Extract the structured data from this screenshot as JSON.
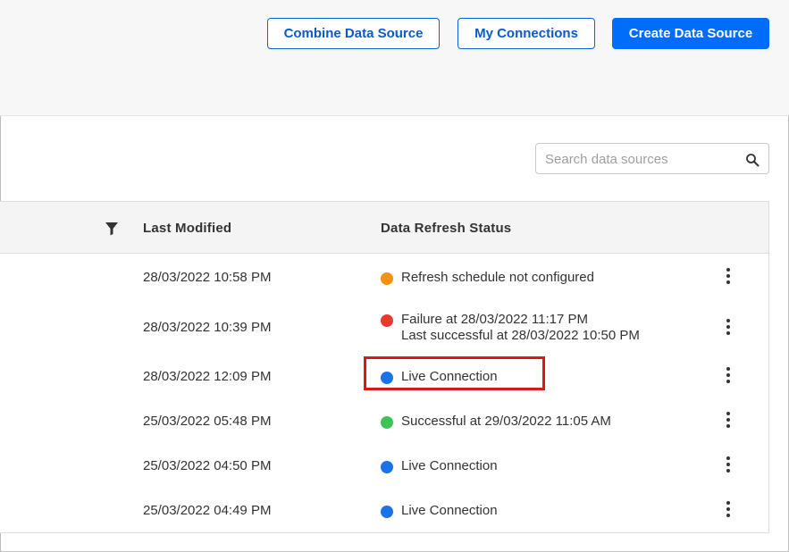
{
  "toolbar": {
    "combine_label": "Combine Data Source",
    "connections_label": "My Connections",
    "create_label": "Create Data Source"
  },
  "search": {
    "placeholder": "Search data sources",
    "value": "",
    "icon": "search-icon"
  },
  "table": {
    "filter_icon": "filter-icon",
    "headers": {
      "last_modified": "Last Modified",
      "refresh_status": "Data Refresh Status"
    },
    "rows": [
      {
        "modified": "28/03/2022 10:58 PM",
        "status_line1": "Refresh schedule not configured",
        "status_line2": "",
        "status_color": "#f39111"
      },
      {
        "modified": "28/03/2022 10:39 PM",
        "status_line1": "Failure at 28/03/2022 11:17 PM",
        "status_line2": "Last successful at 28/03/2022 10:50 PM",
        "status_color": "#ea3a2e"
      },
      {
        "modified": "28/03/2022 12:09 PM",
        "status_line1": "Live Connection",
        "status_line2": "",
        "status_color": "#1a73e8"
      },
      {
        "modified": "25/03/2022 05:48 PM",
        "status_line1": "Successful at 29/03/2022 11:05 AM",
        "status_line2": "",
        "status_color": "#3ec456"
      },
      {
        "modified": "25/03/2022 04:50 PM",
        "status_line1": "Live Connection",
        "status_line2": "",
        "status_color": "#1a73e8"
      },
      {
        "modified": "25/03/2022 04:49 PM",
        "status_line1": "Live Connection",
        "status_line2": "",
        "status_color": "#1a73e8"
      }
    ]
  },
  "colors": {
    "accent": "#006dfa",
    "highlight": "#e0141e"
  }
}
